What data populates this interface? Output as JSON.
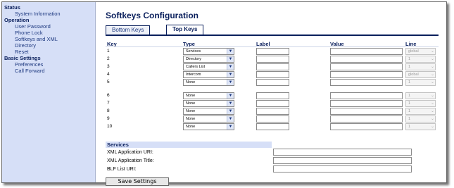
{
  "sidebar": {
    "sections": [
      {
        "heading": "Status",
        "items": [
          "System Information"
        ]
      },
      {
        "heading": "Operation",
        "items": [
          "User Password",
          "Phone Lock",
          "Softkeys and XML",
          "Directory",
          "Reset"
        ]
      },
      {
        "heading": "Basic Settings",
        "items": [
          "Preferences",
          "Call Forward"
        ]
      }
    ]
  },
  "page": {
    "title": "Softkeys Configuration",
    "tabs": [
      "Bottom Keys",
      "Top Keys"
    ],
    "active_tab": "Top Keys"
  },
  "table": {
    "headers": [
      "Key",
      "Type",
      "Label",
      "Value",
      "Line"
    ],
    "rows": [
      {
        "key": "1",
        "type": "Services",
        "line": "global",
        "line_enabled": false
      },
      {
        "key": "2",
        "type": "Directory",
        "line": "1",
        "line_enabled": false
      },
      {
        "key": "3",
        "type": "Callers List",
        "line": "1",
        "line_enabled": false
      },
      {
        "key": "4",
        "type": "Intercom",
        "line": "global",
        "line_enabled": false
      },
      {
        "key": "5",
        "type": "None",
        "line": "1",
        "line_enabled": false
      },
      {
        "key": "6",
        "type": "None",
        "line": "1",
        "line_enabled": false
      },
      {
        "key": "7",
        "type": "None",
        "line": "1",
        "line_enabled": false
      },
      {
        "key": "8",
        "type": "None",
        "line": "1",
        "line_enabled": false
      },
      {
        "key": "9",
        "type": "None",
        "line": "1",
        "line_enabled": false
      },
      {
        "key": "10",
        "type": "None",
        "line": "1",
        "line_enabled": false
      }
    ]
  },
  "services": {
    "heading": "Services",
    "fields": [
      {
        "label": "XML Application URI:",
        "value": ""
      },
      {
        "label": "XML Application Title:",
        "value": ""
      },
      {
        "label": "BLF List URI:",
        "value": ""
      }
    ]
  },
  "actions": {
    "save_label": "Save Settings"
  },
  "colors": {
    "sidebar_bg": "#d6dff7",
    "heading_navy": "#0a1f5c",
    "link_blue": "#1f3a80"
  }
}
